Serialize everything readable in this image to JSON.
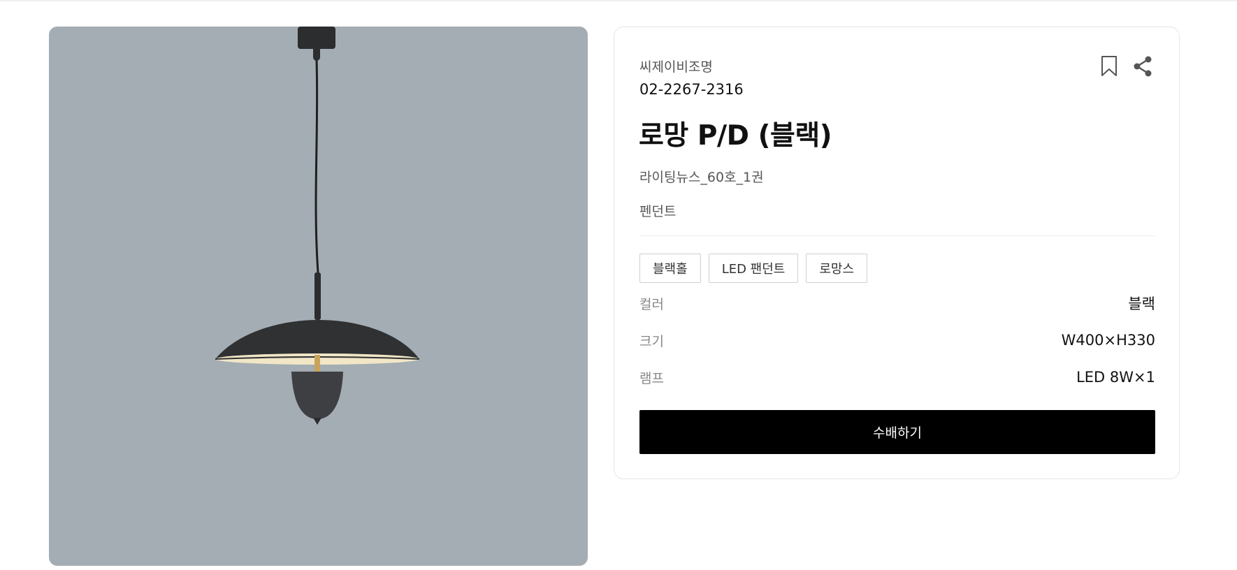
{
  "product": {
    "brand": "씨제이비조명",
    "phone": "02-2267-2316",
    "title": "로망 P/D (블랙)",
    "catalog": "라이팅뉴스_60호_1권",
    "category": "펜던트",
    "image": "pendant-lamp-photo"
  },
  "actions": {
    "bookmark_icon": "bookmark-icon",
    "share_icon": "share-icon",
    "order_label": "수배하기"
  },
  "tags": [
    "블랙홀",
    "LED 팬던트",
    "로망스"
  ],
  "specs": [
    {
      "label": "컬러",
      "value": "블랙"
    },
    {
      "label": "크기",
      "value": "W400×H330"
    },
    {
      "label": "램프",
      "value": "LED 8W×1"
    }
  ],
  "colors": {
    "image_background": "#a4adb3",
    "button": "#000000",
    "button_text": "#ffffff",
    "border": "#e6e6e6"
  }
}
